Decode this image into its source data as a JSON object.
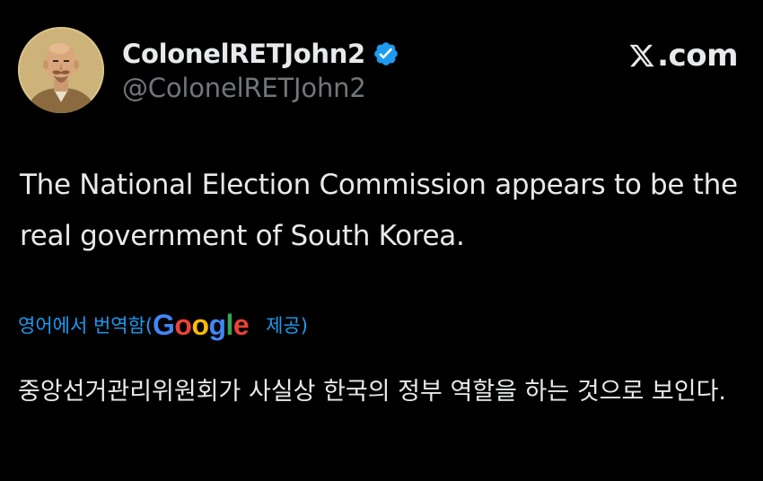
{
  "post": {
    "author": {
      "display_name": "ColonelRETJohn2",
      "handle": "@ColonelRETJohn2",
      "verified": true,
      "avatar_icon": "avatar-illustration-icon"
    },
    "brand": {
      "label": ".com",
      "icon": "x-logo-icon"
    },
    "text": "The National Election Commission appears to be the real government of South Korea.",
    "translation": {
      "prefix": "영어에서 번역함(",
      "provider": "Google",
      "suffix": " 제공)",
      "text": "중앙선거관리위원회가 사실상 한국의 정부 역할을 하는 것으로 보인다."
    }
  },
  "colors": {
    "background": "#000000",
    "text_primary": "#e7e9ea",
    "text_secondary": "#71767b",
    "accent": "#1d9bf0",
    "verified_badge": "#1d9bf0",
    "google_blue": "#4285f4",
    "google_red": "#ea4335",
    "google_yellow": "#fbbc05",
    "google_green": "#34a853"
  }
}
